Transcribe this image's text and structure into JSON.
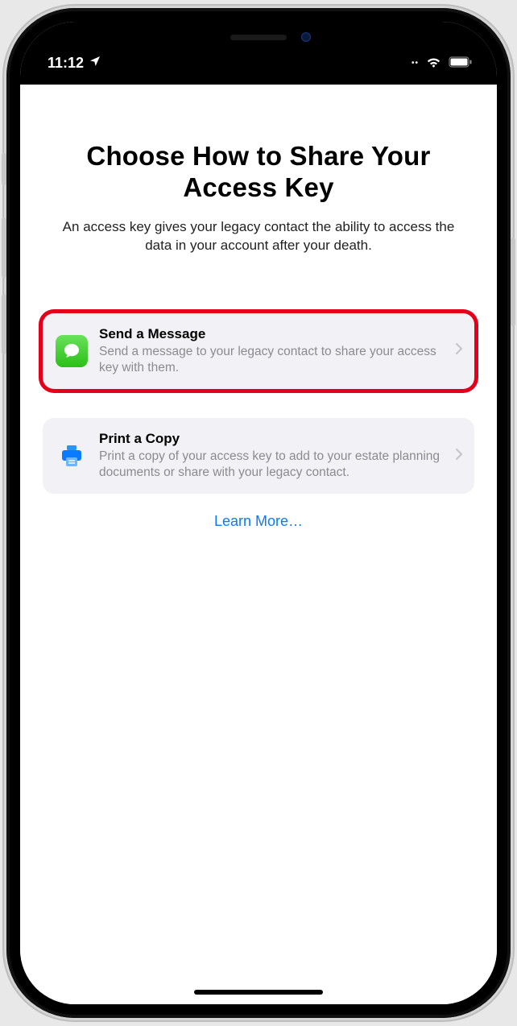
{
  "status": {
    "time": "11:12",
    "location_icon": "location-arrow",
    "wifi_icon": "wifi",
    "battery_icon": "battery-full"
  },
  "page": {
    "title": "Choose How to Share Your Access Key",
    "subtitle": "An access key gives your legacy contact the ability to access the data in your account after your death."
  },
  "options": [
    {
      "icon": "messages-icon",
      "title": "Send a Message",
      "description": "Send a message to your legacy contact to share your access key with them.",
      "highlighted": true
    },
    {
      "icon": "printer-icon",
      "title": "Print a Copy",
      "description": "Print a copy of your access key to add to your estate planning documents or share with your legacy contact.",
      "highlighted": false
    }
  ],
  "learn_more_label": "Learn More…",
  "colors": {
    "link": "#0a7aff",
    "highlight_ring": "#e4001a",
    "card_bg": "#f2f2f6",
    "secondary_text": "#8a8a90"
  }
}
